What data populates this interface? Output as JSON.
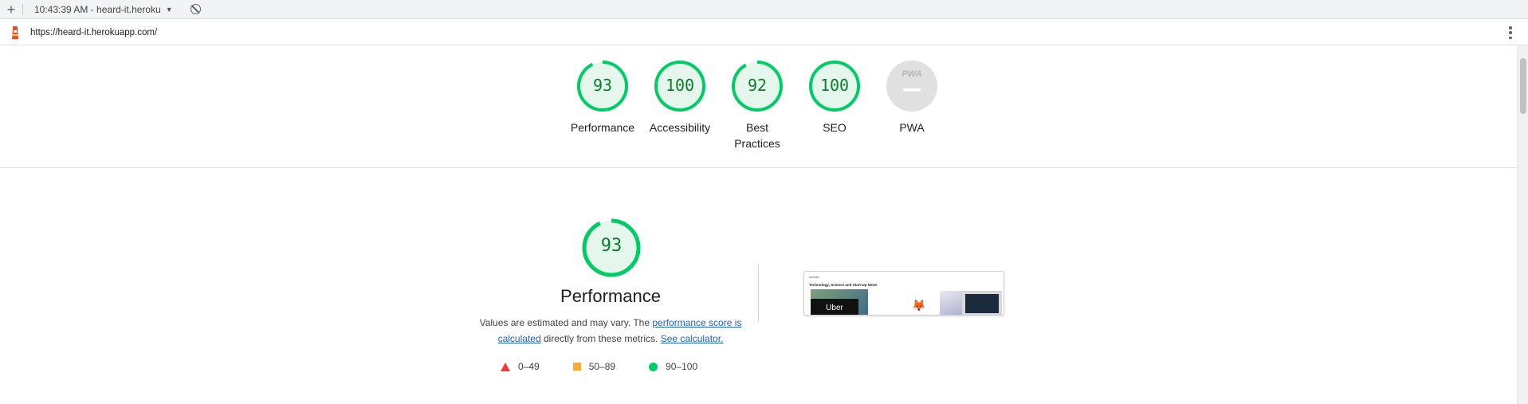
{
  "toolbar": {
    "report_label": "10:43:39 AM - heard-it.heroku"
  },
  "url": "https://heard-it.herokuapp.com/",
  "categories": [
    {
      "score": "93",
      "label": "Performance",
      "fraction": 0.93
    },
    {
      "score": "100",
      "label": "Accessibility",
      "fraction": 1.0
    },
    {
      "score": "92",
      "label": "Best Practices",
      "fraction": 0.92
    },
    {
      "score": "100",
      "label": "SEO",
      "fraction": 1.0
    },
    {
      "score": "",
      "label": "PWA",
      "fraction": 0
    }
  ],
  "pwa_badge_text": "PWA",
  "performance": {
    "score": "93",
    "fraction": 0.93,
    "title": "Performance",
    "desc_1": "Values are estimated and may vary. The ",
    "link_1": "performance score is calculated",
    "desc_2": " directly from these metrics. ",
    "link_2": "See calculator."
  },
  "legend": [
    {
      "range": "0–49",
      "shape": "triangle",
      "color": "#ff3333"
    },
    {
      "range": "50–89",
      "shape": "square",
      "color": "#ffaa33"
    },
    {
      "range": "90–100",
      "shape": "circle",
      "color": "#00cc66"
    }
  ],
  "screenshot": {
    "site_name": "heardit",
    "headline": "Technology, Science and Start-Up News",
    "image_caption": "Uber"
  },
  "colors": {
    "pass": "#00cc66",
    "pass_text": "#0a7d2e",
    "gauge_bg": "#e5f7ec",
    "link": "#1a5fd6"
  }
}
